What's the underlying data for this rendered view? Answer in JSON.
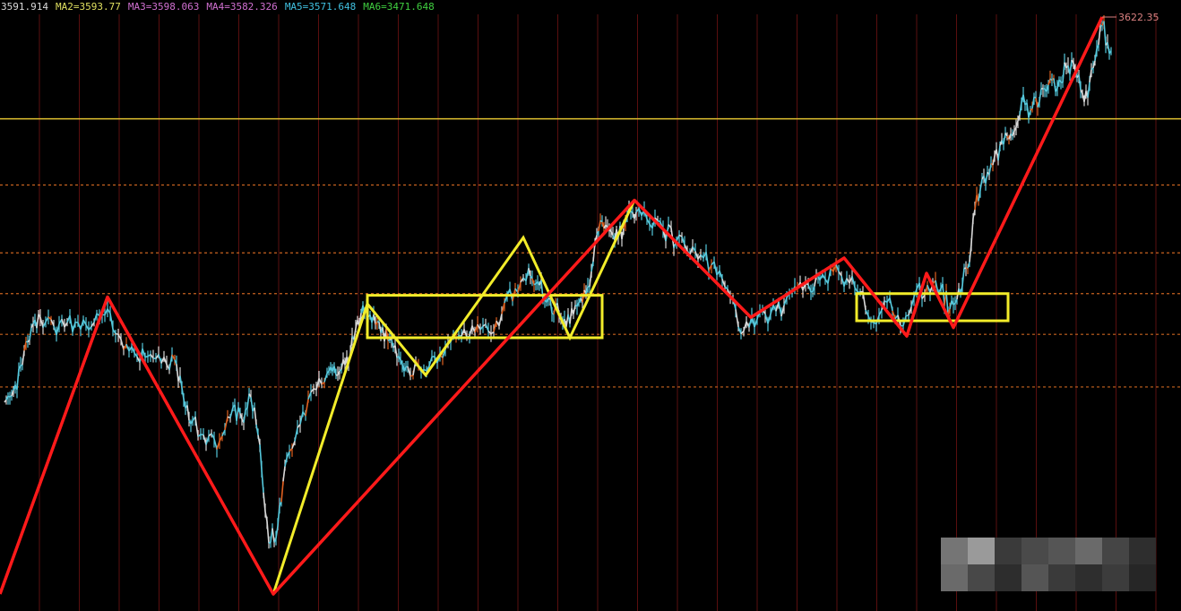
{
  "header": {
    "items": [
      {
        "text": "3591.914",
        "color": "#d9d9d9"
      },
      {
        "text": "MA2=3593.77",
        "color": "#e0e060"
      },
      {
        "text": "MA3=3598.063",
        "color": "#d070d0"
      },
      {
        "text": "MA4=3582.326",
        "color": "#d070d0"
      },
      {
        "text": "MA5=3571.648",
        "color": "#40c0e0"
      },
      {
        "text": "MA6=3471.648",
        "color": "#40d040"
      }
    ]
  },
  "peak_label": "3622.35",
  "colors": {
    "background": "#000000",
    "zigzag": "#ff1a1a",
    "pattern": "#f2ec2a",
    "grid_vertical": "#5a0f0f",
    "grid_horizontal": "#c8631f",
    "price_up": "#55c8dc",
    "price_down": "#d8d8d8",
    "price_accent": "#e06020",
    "resistance": "#e0c030"
  },
  "chart_data": {
    "type": "line",
    "y_axis": {
      "range": [
        3280,
        3640
      ]
    },
    "resistance_level": 3570,
    "reference_levels": [
      3531,
      3491,
      3467,
      3443,
      3412
    ],
    "zigzag": [
      [
        0,
        3290
      ],
      [
        120,
        3465
      ],
      [
        305,
        3290
      ],
      [
        708,
        3522
      ],
      [
        838,
        3453
      ],
      [
        942,
        3488
      ],
      [
        1012,
        3442
      ],
      [
        1034,
        3479
      ],
      [
        1064,
        3447
      ],
      [
        1230,
        3630
      ]
    ],
    "patterns": {
      "polyline": [
        [
          305,
          3290
        ],
        [
          410,
          3461
        ],
        [
          475,
          3419
        ],
        [
          584,
          3500
        ],
        [
          636,
          3441
        ],
        [
          708,
          3522
        ]
      ],
      "boxes": [
        {
          "x": [
            410,
            672
          ],
          "y": [
            3441,
            3466
          ]
        },
        {
          "x": [
            956,
            1125
          ],
          "y": [
            3451,
            3467
          ]
        }
      ]
    },
    "series": {
      "values": [
        [
          5,
          3403
        ],
        [
          15,
          3410
        ],
        [
          25,
          3425
        ],
        [
          35,
          3447
        ],
        [
          45,
          3453
        ],
        [
          60,
          3448
        ],
        [
          75,
          3450
        ],
        [
          90,
          3446
        ],
        [
          105,
          3450
        ],
        [
          120,
          3458
        ],
        [
          135,
          3440
        ],
        [
          150,
          3432
        ],
        [
          165,
          3430
        ],
        [
          180,
          3426
        ],
        [
          195,
          3428
        ],
        [
          205,
          3405
        ],
        [
          215,
          3392
        ],
        [
          230,
          3378
        ],
        [
          245,
          3380
        ],
        [
          260,
          3400
        ],
        [
          270,
          3393
        ],
        [
          280,
          3406
        ],
        [
          290,
          3378
        ],
        [
          300,
          3320
        ],
        [
          310,
          3330
        ],
        [
          320,
          3370
        ],
        [
          335,
          3390
        ],
        [
          350,
          3411
        ],
        [
          365,
          3420
        ],
        [
          375,
          3419
        ],
        [
          385,
          3425
        ],
        [
          395,
          3440
        ],
        [
          405,
          3460
        ],
        [
          415,
          3450
        ],
        [
          425,
          3444
        ],
        [
          435,
          3440
        ],
        [
          445,
          3430
        ],
        [
          455,
          3424
        ],
        [
          470,
          3421
        ],
        [
          485,
          3430
        ],
        [
          500,
          3438
        ],
        [
          515,
          3442
        ],
        [
          530,
          3444
        ],
        [
          545,
          3445
        ],
        [
          560,
          3455
        ],
        [
          575,
          3470
        ],
        [
          590,
          3482
        ],
        [
          600,
          3474
        ],
        [
          610,
          3462
        ],
        [
          620,
          3460
        ],
        [
          630,
          3452
        ],
        [
          640,
          3455
        ],
        [
          650,
          3462
        ],
        [
          660,
          3480
        ],
        [
          670,
          3510
        ],
        [
          680,
          3505
        ],
        [
          690,
          3500
        ],
        [
          700,
          3512
        ],
        [
          710,
          3515
        ],
        [
          725,
          3508
        ],
        [
          740,
          3505
        ],
        [
          755,
          3498
        ],
        [
          770,
          3490
        ],
        [
          785,
          3488
        ],
        [
          800,
          3478
        ],
        [
          815,
          3465
        ],
        [
          830,
          3445
        ],
        [
          845,
          3452
        ],
        [
          860,
          3455
        ],
        [
          875,
          3460
        ],
        [
          890,
          3470
        ],
        [
          905,
          3468
        ],
        [
          915,
          3475
        ],
        [
          930,
          3480
        ],
        [
          945,
          3476
        ],
        [
          960,
          3468
        ],
        [
          975,
          3450
        ],
        [
          990,
          3462
        ],
        [
          1005,
          3448
        ],
        [
          1020,
          3465
        ],
        [
          1035,
          3472
        ],
        [
          1050,
          3470
        ],
        [
          1060,
          3458
        ],
        [
          1070,
          3470
        ],
        [
          1080,
          3482
        ],
        [
          1090,
          3525
        ],
        [
          1100,
          3532
        ],
        [
          1110,
          3548
        ],
        [
          1120,
          3555
        ],
        [
          1130,
          3560
        ],
        [
          1140,
          3580
        ],
        [
          1150,
          3575
        ],
        [
          1160,
          3580
        ],
        [
          1170,
          3590
        ],
        [
          1180,
          3588
        ],
        [
          1190,
          3600
        ],
        [
          1200,
          3598
        ],
        [
          1210,
          3580
        ],
        [
          1220,
          3600
        ],
        [
          1230,
          3625
        ],
        [
          1240,
          3610
        ]
      ]
    }
  },
  "pixel_colors": [
    "#757575",
    "#9a9a9a",
    "#3a3a3a",
    "#4a4a4a",
    "#555555",
    "#6a6a6a",
    "#454545",
    "#2e2e2e",
    "#6a6a6a",
    "#484848",
    "#2d2d2d",
    "#555555",
    "#3a3a3a",
    "#2e2e2e",
    "#3c3c3c",
    "#262626"
  ]
}
